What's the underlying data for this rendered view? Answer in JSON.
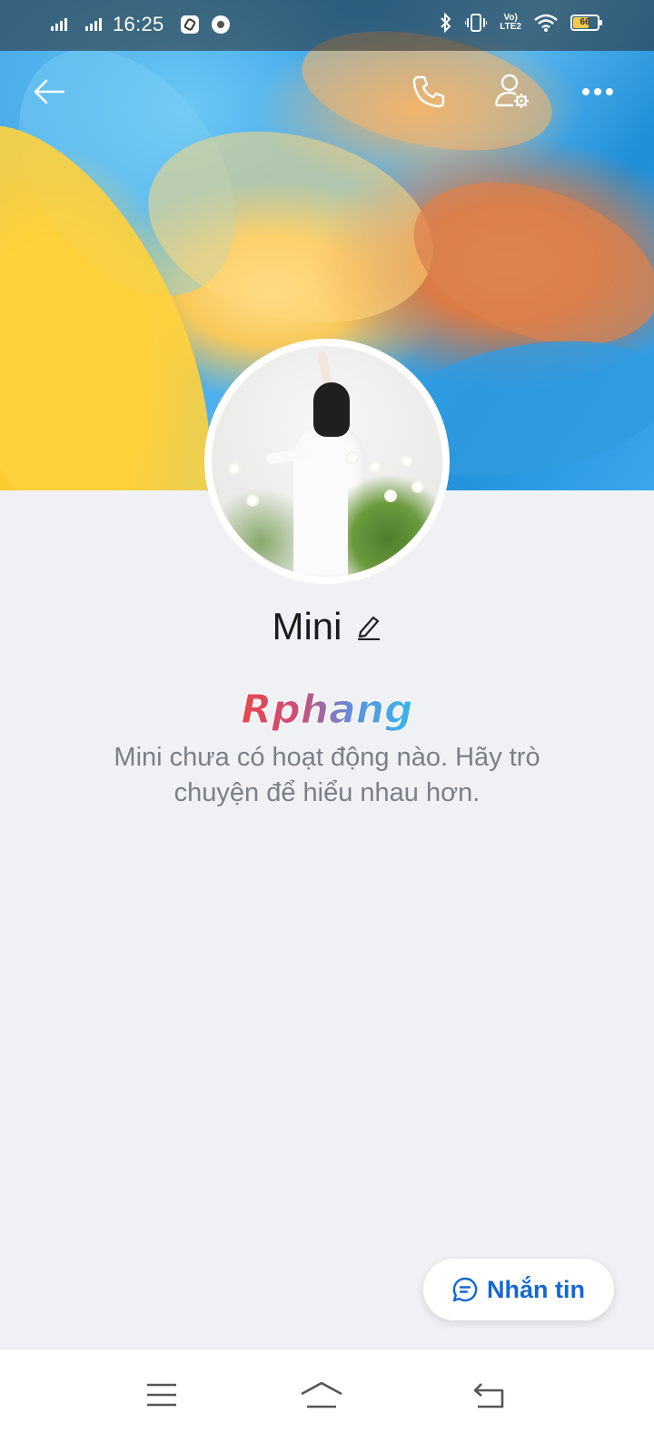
{
  "status_bar": {
    "time": "16:25",
    "volte_line1": "Vo)",
    "volte_line2": "LTE2",
    "battery_level": "66",
    "battery_fraction": 0.66,
    "icons": [
      "signal-icon",
      "signal-icon",
      "app-notification-icon",
      "chrome-icon",
      "bluetooth-icon",
      "vibrate-icon",
      "volte-icon",
      "wifi-icon",
      "battery-icon"
    ]
  },
  "header": {
    "icons": [
      "back-arrow-icon",
      "phone-call-icon",
      "user-settings-icon",
      "more-icon"
    ]
  },
  "profile": {
    "name": "Mini",
    "empty_message": "Mini chưa có hoạt động nào. Hãy trò chuyện để hiểu nhau hơn.",
    "watermark_text": "Rphang"
  },
  "actions": {
    "message_label": "Nhắn tin"
  },
  "nav_bar": {
    "icons": [
      "menu-icon",
      "home-icon",
      "back-icon"
    ]
  },
  "colors": {
    "accent": "#1567d3",
    "background": "#f0f1f5",
    "text_secondary": "#7a8088"
  }
}
